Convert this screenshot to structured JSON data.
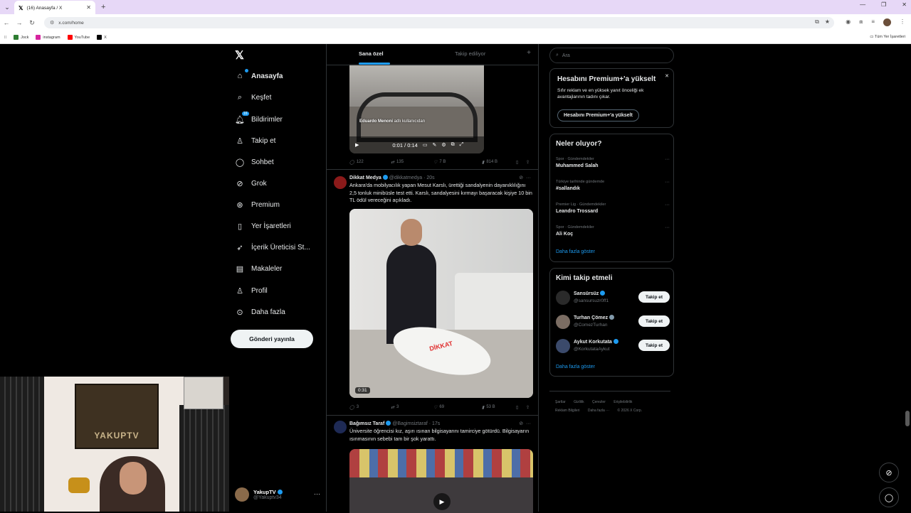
{
  "browser": {
    "tab_title": "(16) Anasayfa / X",
    "url": "x.com/home",
    "bookmarks": [
      "Jock",
      "instagram",
      "YouTube",
      "X"
    ],
    "bookmarks_right": "Tüm Yer İşaretleri"
  },
  "nav": {
    "items": [
      {
        "label": "Anasayfa",
        "icon": "home-icon"
      },
      {
        "label": "Keşfet",
        "icon": "search-icon"
      },
      {
        "label": "Bildirimler",
        "icon": "bell-icon",
        "badge": "16"
      },
      {
        "label": "Takip et",
        "icon": "person-add-icon"
      },
      {
        "label": "Sohbet",
        "icon": "chat-icon"
      },
      {
        "label": "Grok",
        "icon": "grok-icon"
      },
      {
        "label": "Premium",
        "icon": "premium-icon"
      },
      {
        "label": "Yer İşaretleri",
        "icon": "bookmark-icon"
      },
      {
        "label": "İçerik Üreticisi St...",
        "icon": "rocket-icon"
      },
      {
        "label": "Makaleler",
        "icon": "article-icon"
      },
      {
        "label": "Profil",
        "icon": "profile-icon"
      },
      {
        "label": "Daha fazla",
        "icon": "more-icon"
      }
    ],
    "post_button": "Gönderi yayınla",
    "account": {
      "name": "YakupTV",
      "handle": "@Yakuptv34"
    }
  },
  "webcam": {
    "poster_text": "YAKUPTV"
  },
  "feed": {
    "tabs": [
      "Sana özel",
      "Takip ediliyor"
    ],
    "post1": {
      "caption_name": "Eduardo Menoni",
      "caption_suffix": "adlı kullanıcıdan",
      "time": "0:01 / 0:14",
      "replies": "122",
      "reposts": "135",
      "likes": "7 B",
      "views": "814 B"
    },
    "post2": {
      "name": "Dikkat Medya",
      "handle": "@dikkatmedya",
      "age": "· 20s",
      "text": "Ankara'da mobilyacılık yapan Mesut Karslı, ürettiği sandalyenin dayanıklılığını 2,5 tonluk minibüsle test etti. Karslı, sandalyesini kırmayı başaracak kişiye 10 bin TL ödül vereceğini açıkladı.",
      "logo": "DİKKAT",
      "duration": "0:31",
      "replies": "3",
      "reposts": "3",
      "likes": "69",
      "views": "53 B"
    },
    "post3": {
      "name": "Bağımsız Taraf",
      "handle": "@Bagimsiztaraf",
      "age": "· 17s",
      "text": "Üniversite öğrencisi kız, aşırı ısınan bilgisayarını tamirciye götürdü. Bilgisayarın ısınmasının sebebi tam bir şok yarattı."
    }
  },
  "right": {
    "search_placeholder": "Ara",
    "premium": {
      "title": "Hesabını Premium+'a yükselt",
      "desc": "Sıfır reklam ve en yüksek yanıt önceliği ek avantajlarının tadını çıkar.",
      "button": "Hesabını Premium+'a yükselt"
    },
    "trends_title": "Neler oluyor?",
    "trends": [
      {
        "context": "Spor · Gündemdekiler",
        "name": "Muhammed Salah"
      },
      {
        "context": "Türkiye tarihinde gündemde",
        "name": "#sallandık"
      },
      {
        "context": "Premier Lig · Gündemdekiler",
        "name": "Leandro Trossard"
      },
      {
        "context": "Spor · Gündemdekiler",
        "name": "Ali Koç"
      }
    ],
    "show_more": "Daha fazla göster",
    "follow_title": "Kimi takip etmeli",
    "follow": [
      {
        "name": "Sansürsüz",
        "handle": "@sansursuzr0ff1",
        "color": "#2a2a2a"
      },
      {
        "name": "Turhan Çömez",
        "handle": "@ComezTurhan",
        "color": "#7b6d63"
      },
      {
        "name": "Aykut Korkutata",
        "handle": "@KorkutataAykut",
        "color": "#3b4a6b"
      }
    ],
    "follow_button": "Takip et",
    "footer": [
      "Şartlar",
      "Gizlilik",
      "Çerezler",
      "Erişilebilirlik",
      "Reklam Bilgileri",
      "Daha fazla ···",
      "© 2026 X Corp."
    ]
  }
}
